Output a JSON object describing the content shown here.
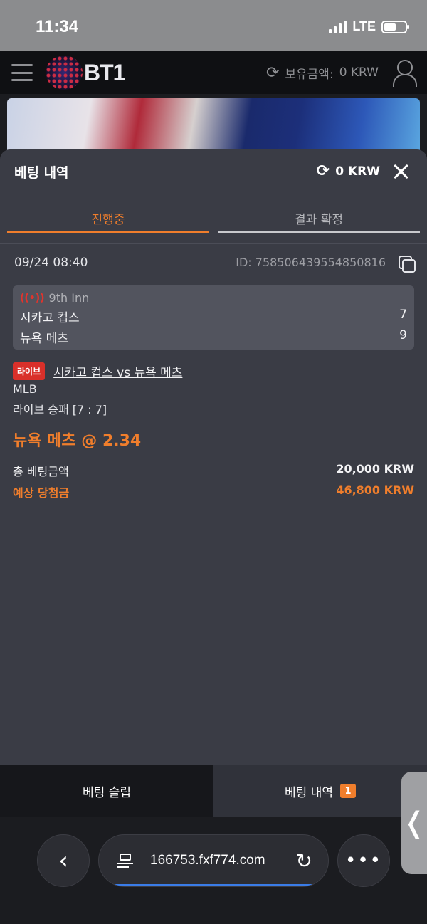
{
  "status": {
    "time": "11:34",
    "network": "LTE"
  },
  "header": {
    "logo": "BT1",
    "balance_label": "보유금액:",
    "balance_value": "0 KRW"
  },
  "panel": {
    "title": "베팅 내역",
    "balance": "0 KRW",
    "tabs": [
      {
        "label": "진행중",
        "active": true
      },
      {
        "label": "결과 확정",
        "active": false
      }
    ]
  },
  "bet": {
    "date": "09/24 08:40",
    "id": "ID: 758506439554850816",
    "inning": "9th Inn",
    "teams": [
      {
        "name": "시카고 컵스",
        "score": "7"
      },
      {
        "name": "뉴욕 메츠",
        "score": "9"
      }
    ],
    "live_badge": "라이브",
    "match": "시카고 컵스 vs 뉴욕 메츠",
    "league": "MLB",
    "market": "라이브 승패 [7 : 7]",
    "pick": "뉴욕 메츠 @ 2.34",
    "stake_label": "총 베팅금액",
    "stake_value": "20,000 KRW",
    "win_label": "예상 당첨금",
    "win_value": "46,800 KRW"
  },
  "bottom_tabs": {
    "slip": "베팅 슬립",
    "history": "베팅 내역",
    "history_count": "1"
  },
  "browser": {
    "url": "166753.fxf774.com"
  },
  "colors": {
    "accent": "#f07e2c",
    "live": "#d9302a",
    "panel": "#3a3c45"
  }
}
